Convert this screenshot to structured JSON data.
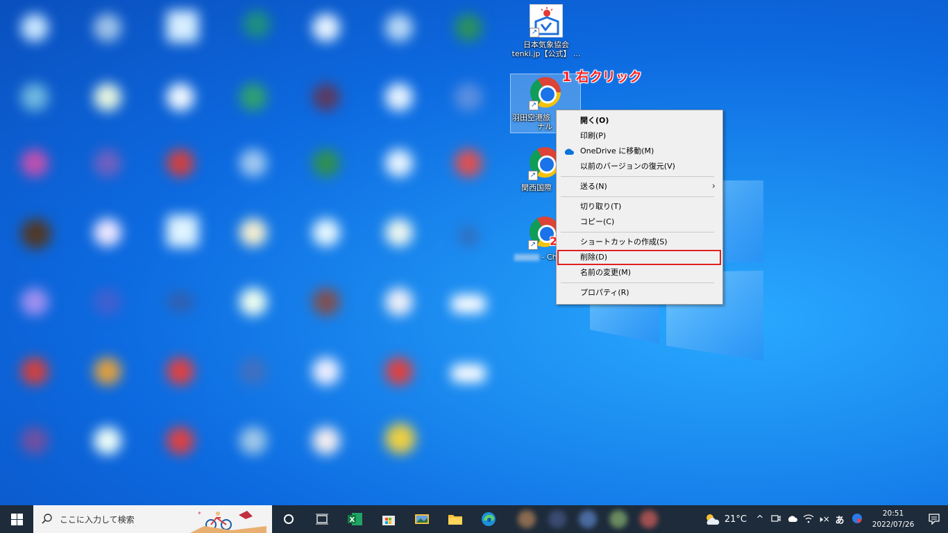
{
  "desktop": {
    "icons": [
      {
        "label_line1": "日本気象協会",
        "label_line2": "tenki.jp【公式】 ..."
      },
      {
        "label_line1": "羽田空港旅",
        "label_line2": "ナル"
      },
      {
        "label_line1": "関西国際",
        "label_line2": ""
      },
      {
        "label_line1": "- Ch",
        "label_line2": ""
      }
    ]
  },
  "annotations": {
    "step1": "1 右クリック",
    "step2": "2"
  },
  "context_menu": {
    "items": [
      {
        "label": "開く(O)",
        "bold": true
      },
      {
        "label": "印刷(P)"
      },
      {
        "label": "OneDrive に移動(M)",
        "icon": "onedrive-cloud-icon"
      },
      {
        "label": "以前のバージョンの復元(V)"
      },
      {
        "label": "送る(N)",
        "submenu": true
      },
      {
        "label": "切り取り(T)"
      },
      {
        "label": "コピー(C)"
      },
      {
        "label": "ショートカットの作成(S)"
      },
      {
        "label": "削除(D)",
        "highlighted": true
      },
      {
        "label": "名前の変更(M)"
      },
      {
        "label": "プロパティ(R)"
      }
    ]
  },
  "taskbar": {
    "search_placeholder": "ここに入力して検索",
    "weather_temp": "21°C",
    "ime_indicator": "あ",
    "clock_time": "20:51",
    "clock_date": "2022/07/26"
  },
  "colors": {
    "annotation_red": "#ff1e1e",
    "taskbar_bg": "#1d2b3a",
    "desktop_blue": "#0d6ae0"
  }
}
